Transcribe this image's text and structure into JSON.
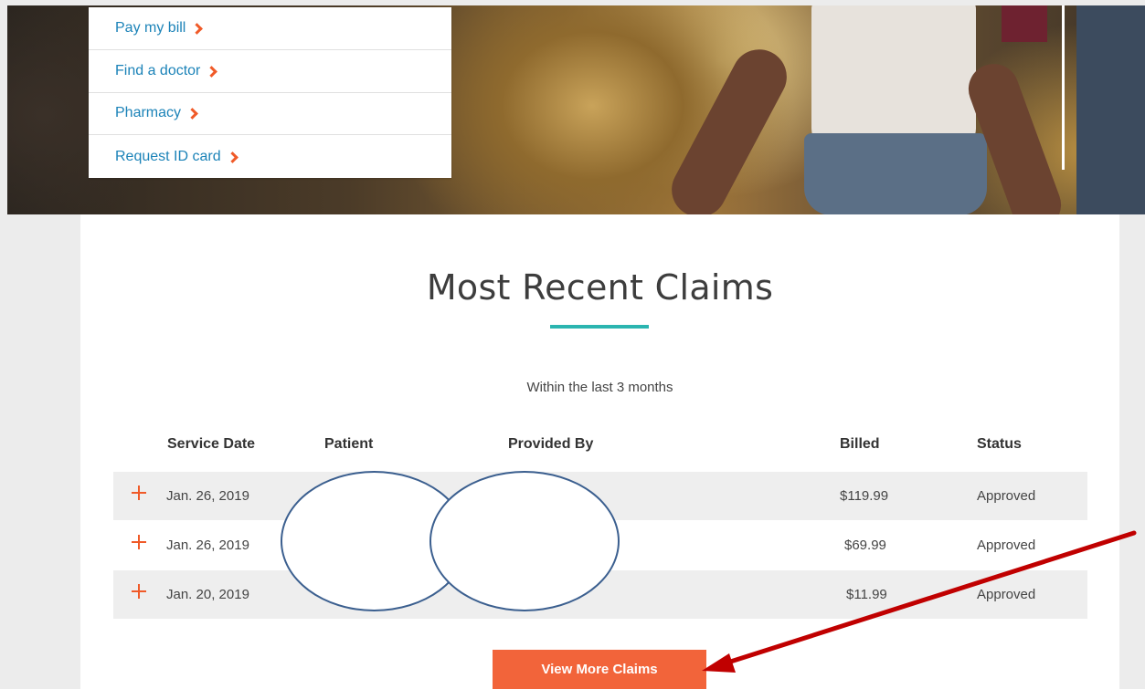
{
  "quick_links": [
    {
      "label": "Pay my bill"
    },
    {
      "label": "Find a doctor"
    },
    {
      "label": "Pharmacy"
    },
    {
      "label": "Request ID card"
    }
  ],
  "claims": {
    "title": "Most Recent Claims",
    "subtitle": "Within the last 3 months",
    "columns": {
      "service_date": "Service Date",
      "patient": "Patient",
      "provided_by": "Provided By",
      "billed": "Billed",
      "status": "Status"
    },
    "rows": [
      {
        "service_date": "Jan. 26, 2019",
        "billed": "$119.99",
        "status": "Approved"
      },
      {
        "service_date": "Jan. 26, 2019",
        "billed": "$69.99",
        "status": "Approved"
      },
      {
        "service_date": "Jan. 20, 2019",
        "billed": "$11.99",
        "status": "Approved"
      }
    ],
    "view_more_label": "View More Claims"
  },
  "colors": {
    "link_blue": "#1c83b8",
    "accent_orange": "#f05a28",
    "underline_teal": "#2bb5b0",
    "button_orange": "#f2643a",
    "annotation_red": "#c00000",
    "redaction_outline": "#3b5f8f"
  },
  "icons": {
    "quick_link_chevron": "chevron-right-icon",
    "row_expand": "plus-icon",
    "annotation_arrow": "arrow-icon"
  }
}
